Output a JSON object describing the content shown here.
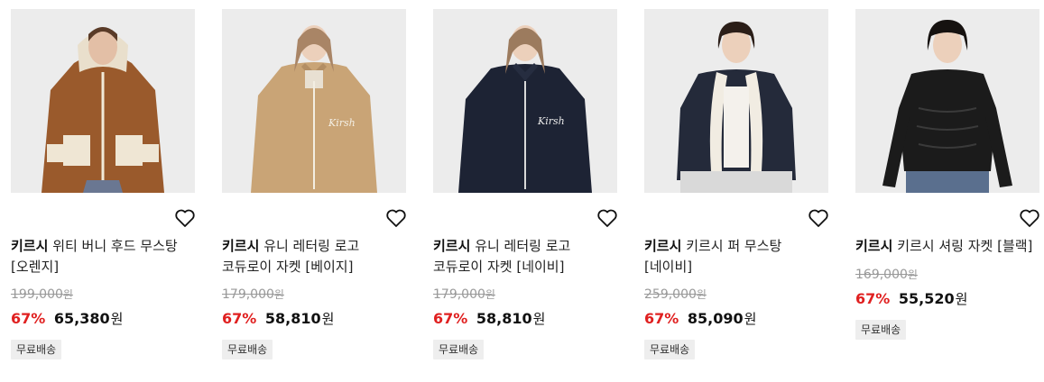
{
  "products": [
    {
      "brand": "키르시",
      "name": "위티 버니 후드 무스탕 [오렌지]",
      "original_price": "199,000",
      "original_unit": "원",
      "discount": "67%",
      "price": "65,380",
      "unit": "원",
      "badge": "무료배송",
      "jacket_color": "#9a5a2c",
      "bg_color": "#ececec"
    },
    {
      "brand": "키르시",
      "name": "유니 레터링 로고 코듀로이 자켓 [베이지]",
      "original_price": "179,000",
      "original_unit": "원",
      "discount": "67%",
      "price": "58,810",
      "unit": "원",
      "badge": "무료배송",
      "jacket_color": "#c9a476",
      "bg_color": "#ececec"
    },
    {
      "brand": "키르시",
      "name": "유니 레터링 로고 코듀로이 자켓 [네이비]",
      "original_price": "179,000",
      "original_unit": "원",
      "discount": "67%",
      "price": "58,810",
      "unit": "원",
      "badge": "무료배송",
      "jacket_color": "#1d2334",
      "bg_color": "#ececec"
    },
    {
      "brand": "키르시",
      "name": "키르시 퍼 무스탕 [네이비]",
      "original_price": "259,000",
      "original_unit": "원",
      "discount": "67%",
      "price": "85,090",
      "unit": "원",
      "badge": "무료배송",
      "jacket_color": "#242a3a",
      "bg_color": "#ececec"
    },
    {
      "brand": "키르시",
      "name": "키르시 셔링 자켓 [블랙]",
      "original_price": "169,000",
      "original_unit": "원",
      "discount": "67%",
      "price": "55,520",
      "unit": "원",
      "badge": "무료배송",
      "jacket_color": "#1b1b1b",
      "bg_color": "#ececec"
    }
  ],
  "icons": {
    "wishlist": "heart-outline-icon"
  },
  "colors": {
    "discount": "#e02020",
    "badge_bg": "#eeeeee",
    "original_price": "#999999"
  }
}
